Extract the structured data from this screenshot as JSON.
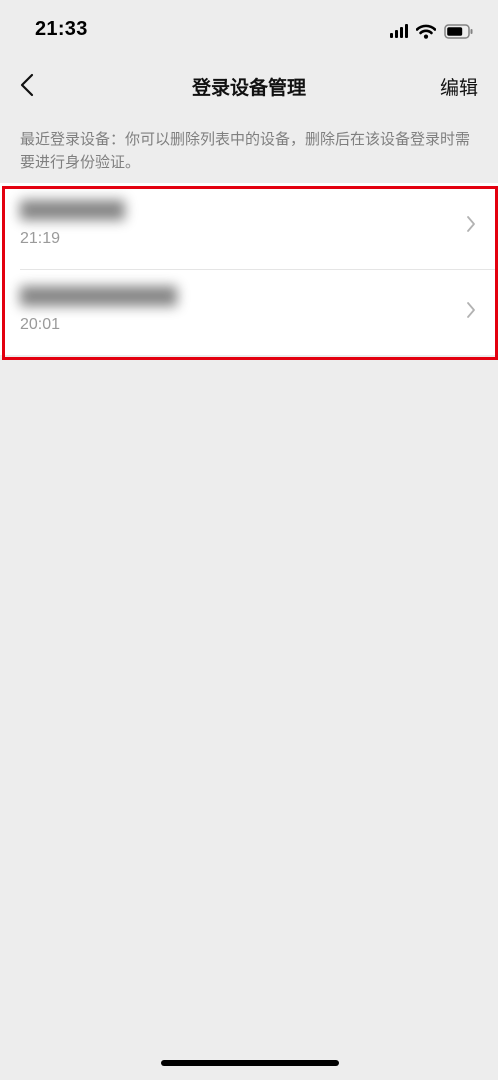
{
  "status_bar": {
    "time": "21:33",
    "icons": [
      "signal-icon",
      "wifi-icon",
      "battery-icon"
    ]
  },
  "nav": {
    "back_icon": "chevron-left-icon",
    "title": "登录设备管理",
    "edit_label": "编辑"
  },
  "description": "最近登录设备：你可以删除列表中的设备，删除后在该设备登录时需要进行身份验证。",
  "devices": [
    {
      "name": "blurred-device-name",
      "time": "21:19",
      "icon": "chevron-right-icon"
    },
    {
      "name": "blurred-device-name",
      "time": "20:01",
      "icon": "chevron-right-icon"
    }
  ],
  "colors": {
    "page_background": "#ededed",
    "list_background": "#ffffff",
    "highlight_border": "#e3000f",
    "secondary_text": "#9a9a9a"
  }
}
